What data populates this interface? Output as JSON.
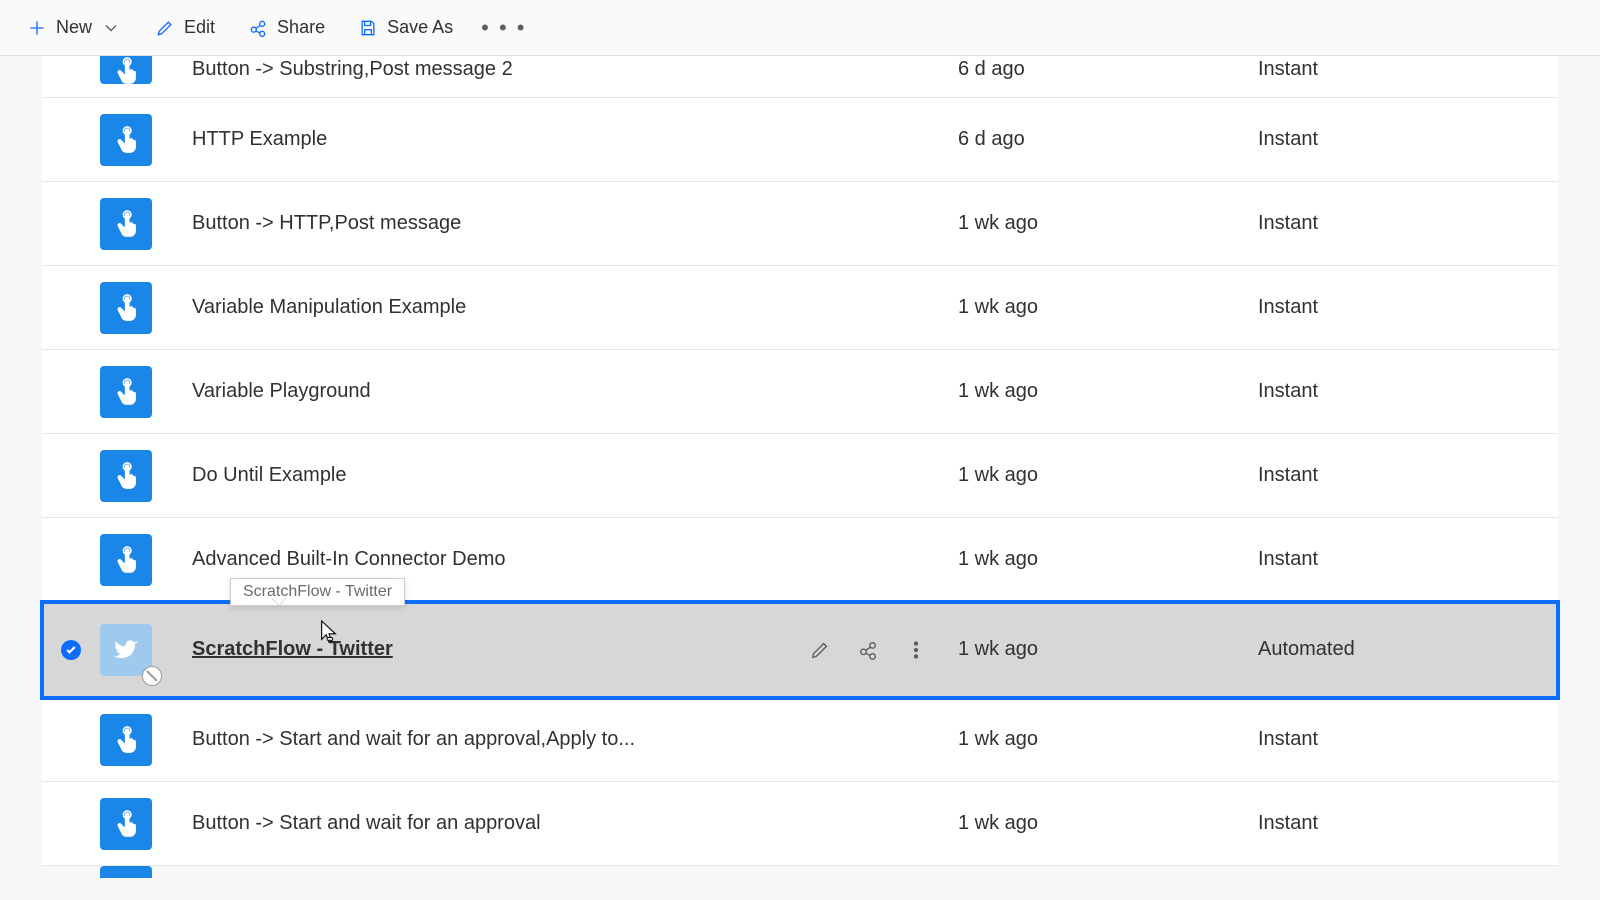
{
  "toolbar": {
    "new": "New",
    "edit": "Edit",
    "share": "Share",
    "saveAs": "Save As"
  },
  "tooltip": "ScratchFlow - Twitter",
  "rows": [
    {
      "name": "Button -> Substring,Post message 2",
      "modified": "6 d ago",
      "type": "Instant",
      "iconKind": "touch",
      "selected": false,
      "cut": true
    },
    {
      "name": "HTTP Example",
      "modified": "6 d ago",
      "type": "Instant",
      "iconKind": "touch",
      "selected": false
    },
    {
      "name": "Button -> HTTP,Post message",
      "modified": "1 wk ago",
      "type": "Instant",
      "iconKind": "touch",
      "selected": false
    },
    {
      "name": "Variable Manipulation Example",
      "modified": "1 wk ago",
      "type": "Instant",
      "iconKind": "touch",
      "selected": false
    },
    {
      "name": "Variable Playground",
      "modified": "1 wk ago",
      "type": "Instant",
      "iconKind": "touch",
      "selected": false
    },
    {
      "name": "Do Until Example",
      "modified": "1 wk ago",
      "type": "Instant",
      "iconKind": "touch",
      "selected": false
    },
    {
      "name": "Advanced Built-In Connector Demo",
      "modified": "1 wk ago",
      "type": "Instant",
      "iconKind": "touch",
      "selected": false
    },
    {
      "name": "ScratchFlow - Twitter",
      "modified": "1 wk ago",
      "type": "Automated",
      "iconKind": "twitter",
      "selected": true,
      "disabled": true
    },
    {
      "name": "Button -> Start and wait for an approval,Apply to...",
      "modified": "1 wk ago",
      "type": "Instant",
      "iconKind": "touch",
      "selected": false
    },
    {
      "name": "Button -> Start and wait for an approval",
      "modified": "1 wk ago",
      "type": "Instant",
      "iconKind": "touch",
      "selected": false
    }
  ]
}
